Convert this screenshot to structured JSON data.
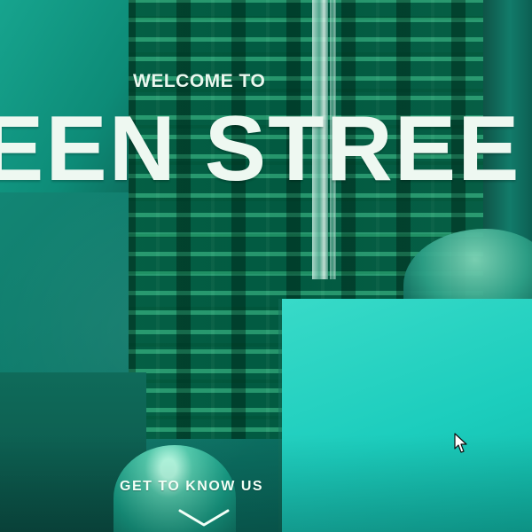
{
  "hero": {
    "welcome_text": "WELCOME TO",
    "headline_text": "EEN STREE",
    "cta_text": "GET TO KNOW US",
    "icons": {
      "cta_arrow": "chevron-down-icon",
      "pointer": "mouse-cursor-icon"
    },
    "colors": {
      "primary_overlay": "#0d7667",
      "highlight": "#38dac8",
      "text": "#eef8f1"
    }
  }
}
